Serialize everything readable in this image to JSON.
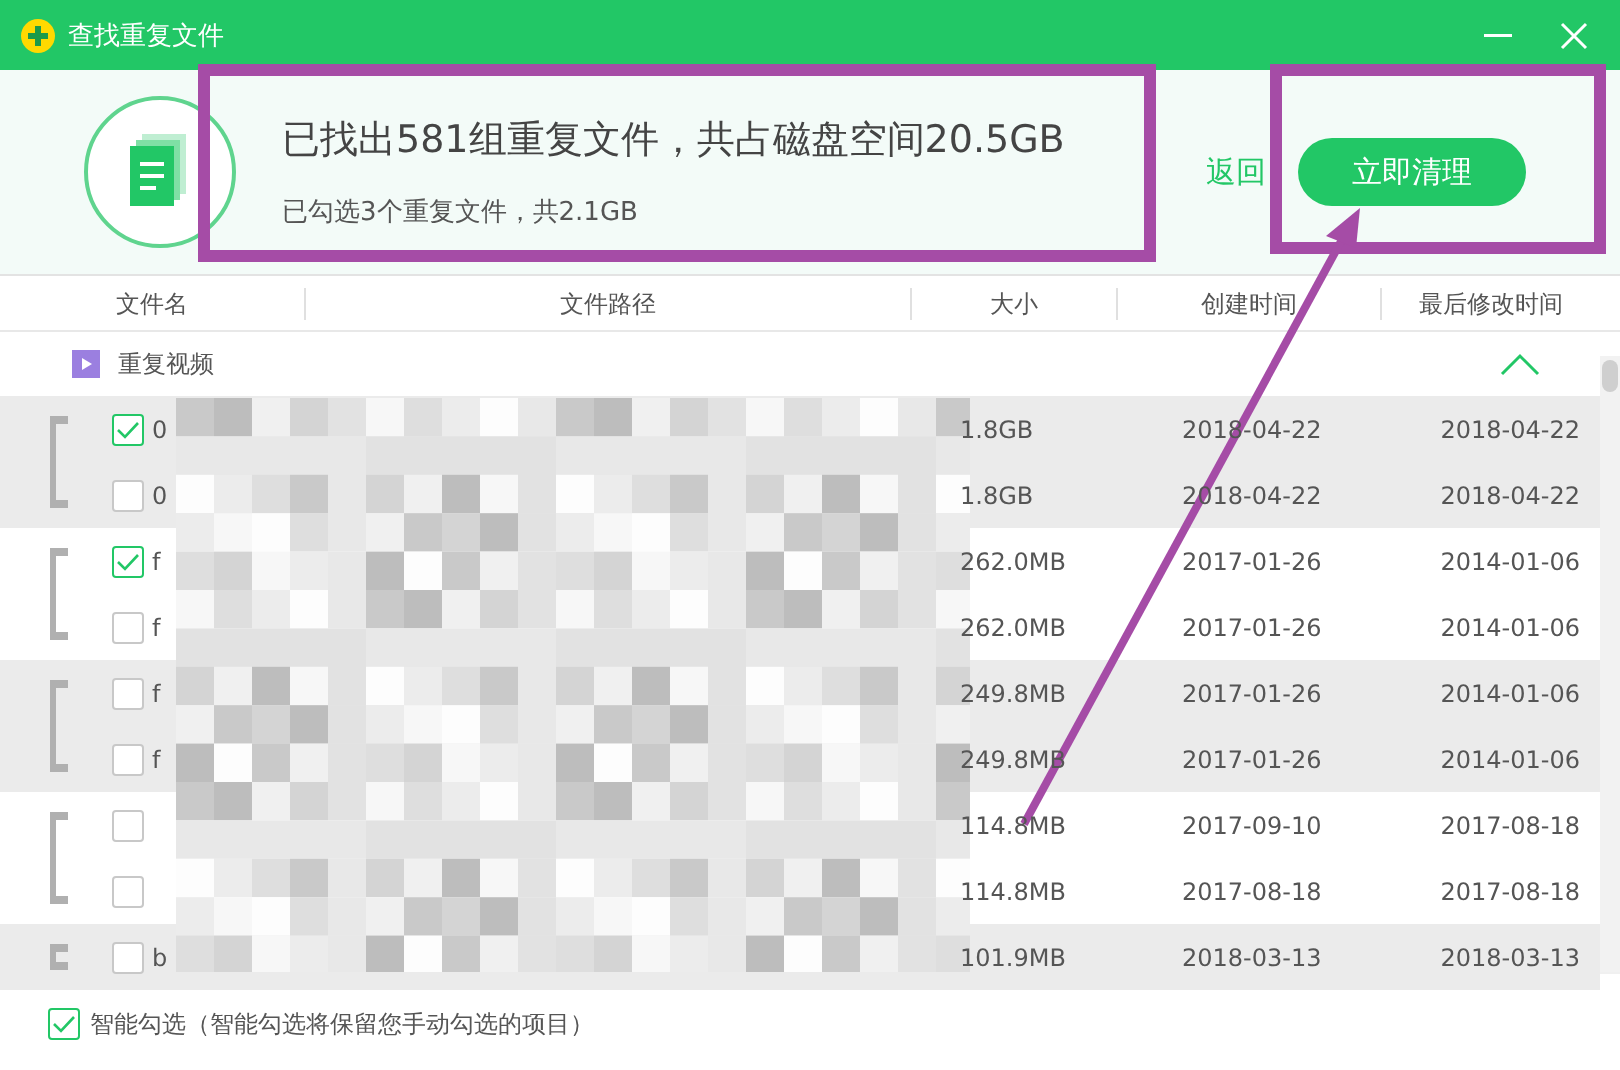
{
  "window": {
    "title": "查找重复文件"
  },
  "summary": {
    "headline": "已找出581组重复文件，共占磁盘空间20.5GB",
    "detail": "已勾选3个重复文件，共2.1GB"
  },
  "actions": {
    "back": "返回",
    "clean": "立即清理"
  },
  "table": {
    "columns": [
      "文件名",
      "文件路径",
      "大小",
      "创建时间",
      "最后修改时间"
    ],
    "category": {
      "label": "重复视频",
      "expanded": true
    },
    "groups": [
      {
        "rows": [
          {
            "name": "0",
            "checked": true,
            "size": "1.8GB",
            "created": "2018-04-22",
            "modified": "2018-04-22"
          },
          {
            "name": "0",
            "checked": false,
            "size": "1.8GB",
            "created": "2018-04-22",
            "modified": "2018-04-22"
          }
        ]
      },
      {
        "rows": [
          {
            "name": "f",
            "checked": true,
            "size": "262.0MB",
            "created": "2017-01-26",
            "modified": "2014-01-06"
          },
          {
            "name": "f",
            "checked": false,
            "size": "262.0MB",
            "created": "2017-01-26",
            "modified": "2014-01-06"
          }
        ]
      },
      {
        "rows": [
          {
            "name": "f",
            "checked": false,
            "size": "249.8MB",
            "created": "2017-01-26",
            "modified": "2014-01-06"
          },
          {
            "name": "f",
            "checked": false,
            "size": "249.8MB",
            "created": "2017-01-26",
            "modified": "2014-01-06"
          }
        ]
      },
      {
        "rows": [
          {
            "checked": false,
            "size": "114.8MB",
            "created": "2017-09-10",
            "modified": "2017-08-18"
          },
          {
            "checked": false,
            "size": "114.8MB",
            "created": "2017-08-18",
            "modified": "2017-08-18"
          }
        ]
      },
      {
        "rows": [
          {
            "name": "b",
            "checked": false,
            "size": "101.9MB",
            "created": "2018-03-13",
            "modified": "2018-03-13"
          }
        ]
      }
    ]
  },
  "footer": {
    "smart_select": {
      "label": "智能勾选（智能勾选将保留您手动勾选的项目）",
      "checked": true
    }
  }
}
